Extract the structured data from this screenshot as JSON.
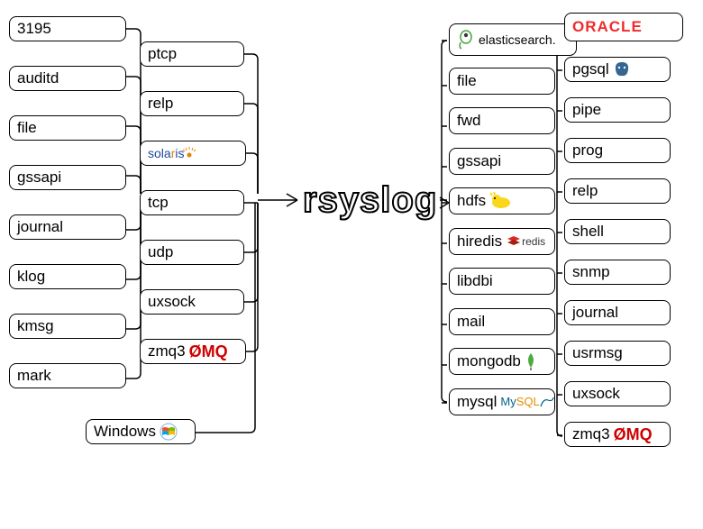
{
  "center": "rsyslog",
  "inputs": {
    "colA": [
      "3195",
      "auditd",
      "file",
      "gssapi",
      "journal",
      "klog",
      "kmsg",
      "mark"
    ],
    "colB": [
      {
        "label": "ptcp",
        "icon": null
      },
      {
        "label": "relp",
        "icon": null
      },
      {
        "label": "solaris",
        "icon": "solaris"
      },
      {
        "label": "tcp",
        "icon": null
      },
      {
        "label": "udp",
        "icon": null
      },
      {
        "label": "uxsock",
        "icon": null
      },
      {
        "label": "zmq3",
        "icon": "zmq"
      }
    ],
    "bottom": {
      "label": "Windows",
      "icon": "windows"
    }
  },
  "outputs": {
    "colC": [
      {
        "label": "elasticsearch.",
        "icon": "elastic"
      },
      {
        "label": "file",
        "icon": null
      },
      {
        "label": "fwd",
        "icon": null
      },
      {
        "label": "gssapi",
        "icon": null
      },
      {
        "label": "hdfs",
        "icon": "hadoop"
      },
      {
        "label": "hiredis",
        "icon": "redis"
      },
      {
        "label": "libdbi",
        "icon": null
      },
      {
        "label": "mail",
        "icon": null
      },
      {
        "label": "mongodb",
        "icon": "mongo"
      },
      {
        "label": "mysql",
        "icon": "mysql"
      }
    ],
    "colD": [
      {
        "label": "ORACLE",
        "icon": "oracle"
      },
      {
        "label": "pgsql",
        "icon": "pgsql"
      },
      {
        "label": "pipe",
        "icon": null
      },
      {
        "label": "prog",
        "icon": null
      },
      {
        "label": "relp",
        "icon": null
      },
      {
        "label": "shell",
        "icon": null
      },
      {
        "label": "snmp",
        "icon": null
      },
      {
        "label": "journal",
        "icon": null
      },
      {
        "label": "usrmsg",
        "icon": null
      },
      {
        "label": "uxsock",
        "icon": null
      },
      {
        "label": "zmq3",
        "icon": "zmq"
      }
    ]
  },
  "brands": {
    "zmq": "ØMQ",
    "redis": "redis",
    "mysql": "MySQL",
    "solaris": "solaris",
    "oracle": "ORACLE"
  }
}
